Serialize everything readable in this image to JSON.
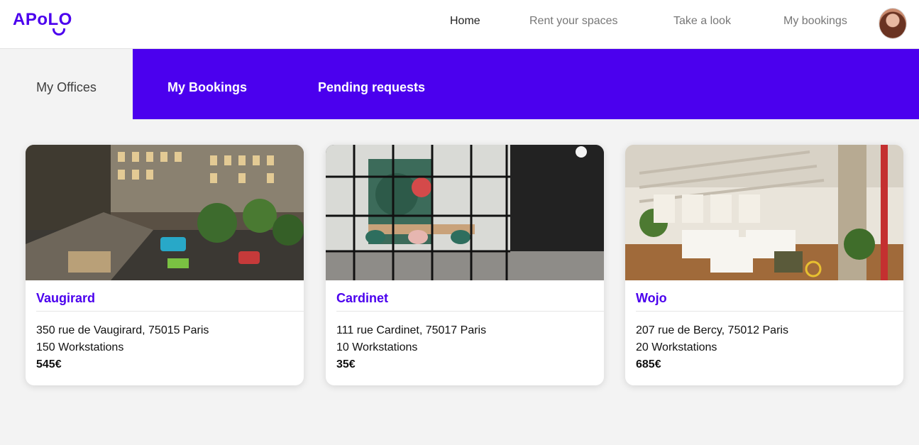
{
  "header": {
    "logo_text": "APoLO",
    "nav": [
      "Home",
      "Rent your spaces",
      "Take a look",
      "My bookings"
    ]
  },
  "tabs": [
    "My Offices",
    "My Bookings",
    "Pending requests"
  ],
  "offices": [
    {
      "name": "Vaugirard",
      "address": "350 rue de Vaugirard, 75015 Paris",
      "workstations": "150 Workstations",
      "price": "545€"
    },
    {
      "name": "Cardinet",
      "address": "111 rue Cardinet, 75017 Paris",
      "workstations": "10 Workstations",
      "price": "35€"
    },
    {
      "name": "Wojo",
      "address": "207 rue de Bercy, 75012 Paris",
      "workstations": "20 Workstations",
      "price": "685€"
    }
  ],
  "colors": {
    "brand": "#4b00ee",
    "background": "#f3f3f3"
  }
}
